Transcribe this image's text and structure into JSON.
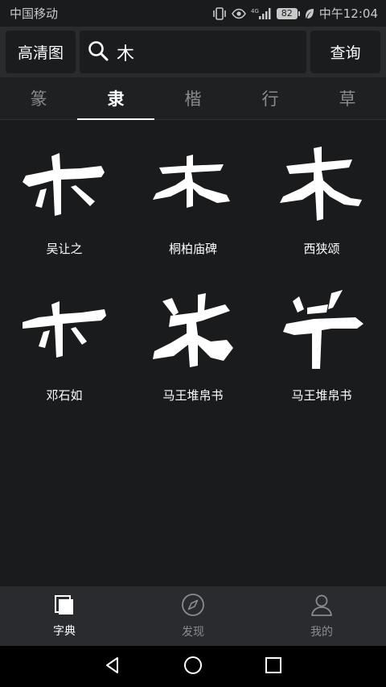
{
  "status_bar": {
    "carrier": "中国移动",
    "network": "4G",
    "battery": "82",
    "time": "中午12:04"
  },
  "top_bar": {
    "hd_label": "高清图",
    "search_value": "木",
    "query_label": "查询"
  },
  "tabs": [
    {
      "label": "篆",
      "active": false
    },
    {
      "label": "隶",
      "active": true
    },
    {
      "label": "楷",
      "active": false
    },
    {
      "label": "行",
      "active": false
    },
    {
      "label": "草",
      "active": false
    }
  ],
  "results": [
    {
      "label": "吴让之"
    },
    {
      "label": "桐柏庙碑"
    },
    {
      "label": "西狭颂"
    },
    {
      "label": "邓石如"
    },
    {
      "label": "马王堆帛书"
    },
    {
      "label": "马王堆帛书"
    }
  ],
  "bottom_nav": [
    {
      "label": "字典",
      "icon": "dictionary-icon",
      "active": true
    },
    {
      "label": "发现",
      "icon": "compass-icon",
      "active": false
    },
    {
      "label": "我的",
      "icon": "person-icon",
      "active": false
    }
  ]
}
